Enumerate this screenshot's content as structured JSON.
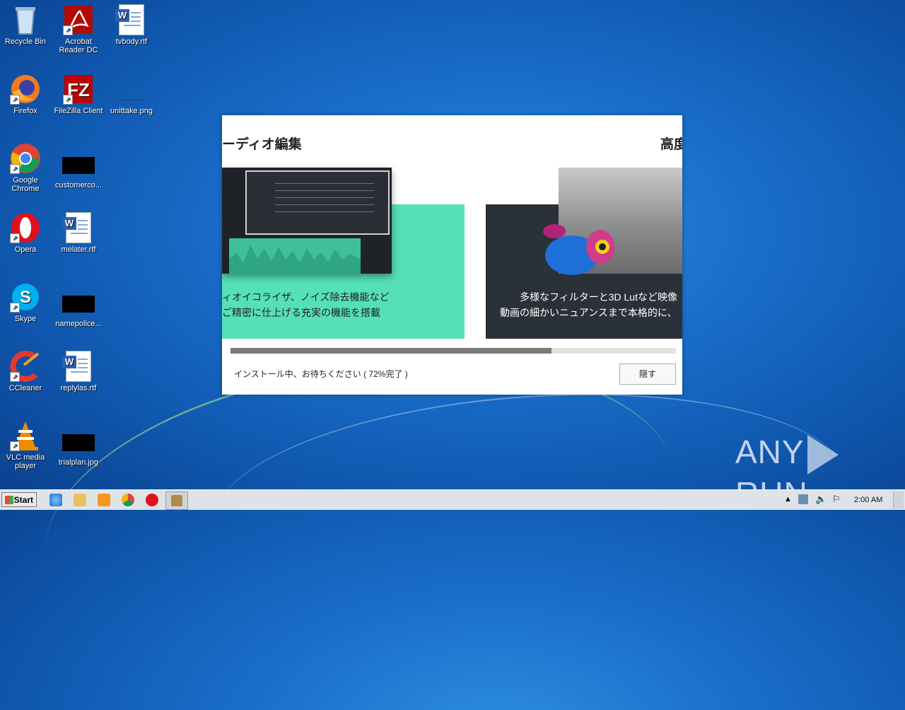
{
  "desktop": {
    "icons": [
      {
        "label": "Recycle Bin"
      },
      {
        "label": "Acrobat Reader DC"
      },
      {
        "label": "tvbody.rtf"
      },
      {
        "label": "Firefox"
      },
      {
        "label": "FileZilla Client"
      },
      {
        "label": "unittake.png"
      },
      {
        "label": "Google Chrome"
      },
      {
        "label": "customerco..."
      },
      {
        "label": "Opera"
      },
      {
        "label": "melater.rtf"
      },
      {
        "label": "Skype"
      },
      {
        "label": "namepolice..."
      },
      {
        "label": "CCleaner"
      },
      {
        "label": "replylas.rtf"
      },
      {
        "label": "VLC media player"
      },
      {
        "label": "trialplan.jpg"
      }
    ]
  },
  "installer": {
    "slide_left_title": "ーディオ編集",
    "slide_right_title": "高度",
    "slide_left_text_line1": "ィオイコライザ、ノイズ除去機能など",
    "slide_left_text_line2": "ご精密に仕上げる充実の機能を搭載",
    "slide_right_text_line1": "多様なフィルターと3D Lutなど映像",
    "slide_right_text_line2": "動画の細かいニュアンスまで本格的に、",
    "progress_fraction": 0.72,
    "status": "インストール中、お待ちください ( 72%完了 )",
    "hide_button": "隠す"
  },
  "watermark": {
    "left": "ANY",
    "right": "RUN"
  },
  "taskbar": {
    "start_label": "Start",
    "clock": "2:00 AM"
  }
}
